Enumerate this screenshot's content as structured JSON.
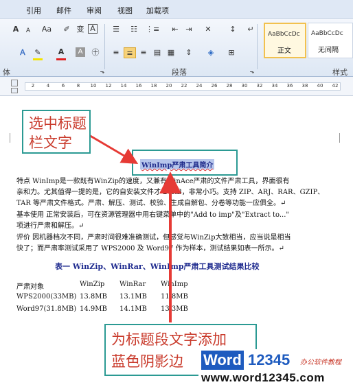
{
  "tabs": [
    "引用",
    "邮件",
    "审阅",
    "视图",
    "加载项"
  ],
  "ribbon": {
    "font_row1": {
      "grow": "A",
      "shrink": "A",
      "change_case": "Aa",
      "phonetic": "变",
      "border": "A"
    },
    "font_row2": {
      "font_color": "A",
      "char_shading": "A"
    },
    "group_font_label": "体",
    "group_paragraph_label": "段落",
    "group_styles_label": "样式",
    "styles": [
      {
        "preview": "AaBbCcDc",
        "name": "正文"
      },
      {
        "preview": "AaBbCcDc",
        "name": "无间隔"
      }
    ]
  },
  "ruler": {
    "ticks": [
      "2",
      "4",
      "6",
      "8",
      "10",
      "12",
      "14",
      "16",
      "18",
      "20",
      "22",
      "24",
      "26",
      "28",
      "30",
      "32",
      "34",
      "36",
      "38",
      "40",
      "42"
    ]
  },
  "document": {
    "heading": "WinImp严肃工具简介",
    "lines": [
      "特点  WinImp是一款既有WinZip的速度，又兼有WinAce严肃的文件严肃工具，界面很有",
      "亲和力。尤其值得一提的是，它的自安装文件才 27KB，非常小巧。支持 ZIP、ARJ、RAR、GZIP、",
      "TAR 等严肃文件格式。严肃、解压、测试、校验、生成自解包、分卷等功能一应俱全。↵",
      "基本使用   正常安装后，可在资源管理器中用右键菜单中的\"Add to imp\"及\"Extract to...\"",
      "项进行严肃和解压。↵",
      "评价   因机器档次不同，严肃时间很难准确测试，但感觉与WinZip大致相当，应当说是相当",
      "快了；而严肃率测试采用了 WPS2000 及 Word97 作为样本，测试结果如表一所示。↵"
    ],
    "table_title": "表一   WinZip、WinRar、WinImp严肃工具测试结果比较",
    "table": {
      "headers": [
        "严肃对象",
        "WinZip",
        "WinRar",
        "WinImp"
      ],
      "rows": [
        [
          "WPS2000(33MB)",
          "13.8MB",
          "13.1MB",
          "11.8MB"
        ],
        [
          "Word97(31.8MB)",
          "14.9MB",
          "14.1MB",
          "13.3MB"
        ]
      ]
    }
  },
  "callouts": {
    "top": [
      "选中标题",
      "栏文字"
    ],
    "bottom": [
      "为标题段文字添加",
      "蓝色阴影边"
    ]
  },
  "watermark": {
    "brand_word": "Word",
    "brand_num": "12345",
    "brand_tag": "办公软件教程",
    "url": "www.word12345.com"
  },
  "colors": {
    "accent": "#2b9a93",
    "arrow": "#e63a35",
    "callout_text": "#c93a2b",
    "heading_shade": "#b7c6ec",
    "table_title": "#1f2b8f"
  }
}
